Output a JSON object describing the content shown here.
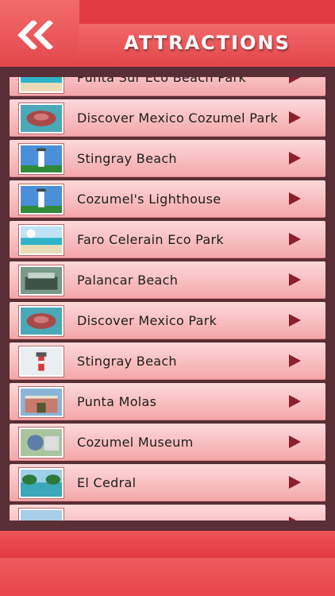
{
  "header": {
    "title": "ATTRACTIONS",
    "back_icon": "double-chevron-left-icon"
  },
  "attractions": [
    {
      "label": "Punta Sur Eco Beach Park",
      "thumb": "beach"
    },
    {
      "label": "Discover Mexico Cozumel Park",
      "thumb": "ray"
    },
    {
      "label": "Stingray Beach",
      "thumb": "lighthouse"
    },
    {
      "label": "Cozumel's Lighthouse",
      "thumb": "lighthouse"
    },
    {
      "label": "Faro Celerain Eco Park",
      "thumb": "beach"
    },
    {
      "label": "Palancar Beach",
      "thumb": "crowd"
    },
    {
      "label": "Discover Mexico Park",
      "thumb": "ray"
    },
    {
      "label": "Stingray Beach",
      "thumb": "tower"
    },
    {
      "label": "Punta Molas",
      "thumb": "building"
    },
    {
      "label": "Cozumel Museum",
      "thumb": "museum"
    },
    {
      "label": "El Cedral",
      "thumb": "lagoon"
    },
    {
      "label": "",
      "thumb": "sky"
    }
  ],
  "colors": {
    "header_red": "#e23b40",
    "row_top": "#fcd9da",
    "row_bottom": "#f4a6a9",
    "arrow": "#8c1f2a",
    "frame": "#5a2e35"
  }
}
